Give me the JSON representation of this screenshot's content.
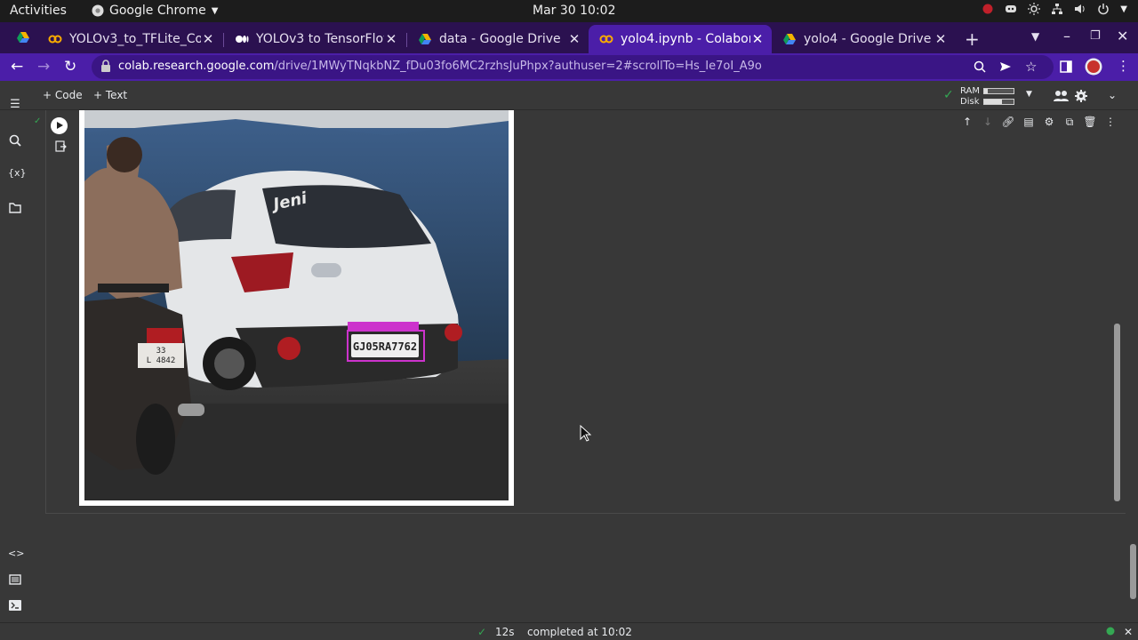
{
  "system_bar": {
    "activities": "Activities",
    "app_name": "Google Chrome",
    "clock": "Mar 30  10:02"
  },
  "tabs": [
    {
      "label": "YOLOv3_to_TFLite_Co",
      "icon": "colab-icon",
      "active": false
    },
    {
      "label": "YOLOv3 to TensorFlow",
      "icon": "medium-icon",
      "active": false
    },
    {
      "label": "data - Google Drive",
      "icon": "google-drive-icon",
      "active": false
    },
    {
      "label": "yolo4.ipynb - Colabora",
      "icon": "colab-icon",
      "active": true
    },
    {
      "label": "yolo4 - Google Drive",
      "icon": "google-drive-icon",
      "active": false
    }
  ],
  "address": {
    "host": "colab.research.google.com",
    "path": "/drive/1MWyTNqkbNZ_fDu03fo6MC2rzhsJuPhpx?authuser=2#scrollTo=Hs_Ie7oI_A9o"
  },
  "toolbar": {
    "add_code": "+ Code",
    "add_text": "+ Text",
    "ram_label": "RAM",
    "disk_label": "Disk",
    "ram_usage": 0.12,
    "disk_usage": 0.62
  },
  "output_image": {
    "plate_text": "GJ05RA7762",
    "bike_plate_line1": "33",
    "bike_plate_line2": "L 4842",
    "car_brand_text": "Jeni"
  },
  "status": {
    "elapsed": "12s",
    "message": "completed at 10:02"
  },
  "colors": {
    "tab_strip": "#2b1150",
    "active_tab": "#4b1ea8",
    "notebook_bg": "#383838",
    "detection_box": "#cc33cc"
  }
}
